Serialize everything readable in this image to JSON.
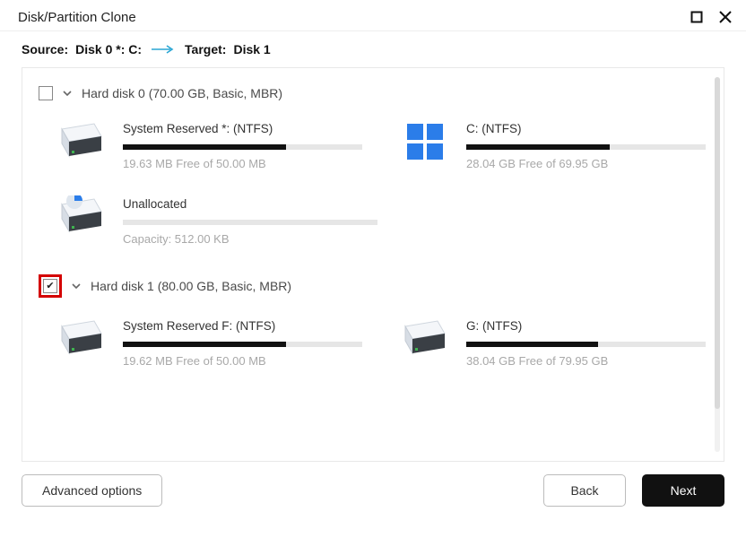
{
  "window": {
    "title": "Disk/Partition Clone"
  },
  "header": {
    "source_label": "Source:",
    "source_value": "Disk 0 *: C:",
    "target_label": "Target:",
    "target_value": "Disk 1"
  },
  "disks": [
    {
      "checked": false,
      "highlighted": false,
      "label": "Hard disk 0 (70.00 GB, Basic, MBR)",
      "partitions": [
        {
          "name": "System Reserved *: (NTFS)",
          "sub": "19.63 MB Free of 50.00 MB",
          "used_pct": 68,
          "icon": "drive",
          "empty": false
        },
        {
          "name": "C: (NTFS)",
          "sub": "28.04 GB Free of 69.95 GB",
          "used_pct": 60,
          "icon": "windows-drive",
          "empty": false
        },
        {
          "name": "Unallocated",
          "sub": "Capacity: 512.00 KB",
          "used_pct": 0,
          "icon": "pie-drive",
          "empty": true
        }
      ]
    },
    {
      "checked": true,
      "highlighted": true,
      "label": "Hard disk 1 (80.00 GB, Basic, MBR)",
      "partitions": [
        {
          "name": "System Reserved F: (NTFS)",
          "sub": "19.62 MB Free of 50.00 MB",
          "used_pct": 68,
          "icon": "drive",
          "empty": false
        },
        {
          "name": "G: (NTFS)",
          "sub": "38.04 GB Free of 79.95 GB",
          "used_pct": 55,
          "icon": "drive",
          "empty": false
        }
      ]
    }
  ],
  "footer": {
    "advanced": "Advanced options",
    "back": "Back",
    "next": "Next"
  }
}
